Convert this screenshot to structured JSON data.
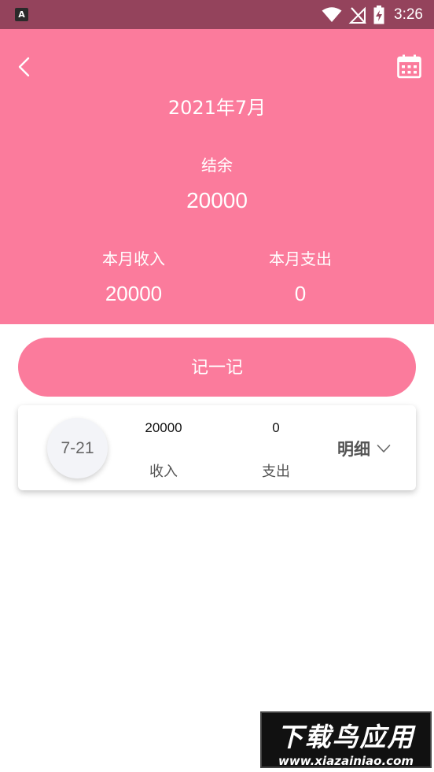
{
  "status_bar": {
    "app_icon_letter": "A",
    "time": "3:26"
  },
  "header": {
    "month": "2021年7月",
    "balance_label": "结余",
    "balance_value": "20000",
    "income_label": "本月收入",
    "income_value": "20000",
    "expense_label": "本月支出",
    "expense_value": "0"
  },
  "record_button": {
    "label": "记一记"
  },
  "day_card": {
    "date": "7-21",
    "income_value": "20000",
    "income_label": "收入",
    "expense_value": "0",
    "expense_label": "支出",
    "detail_label": "明细"
  },
  "watermark": {
    "title": "下载鸟应用",
    "url": "www.xiazainiao.com"
  },
  "colors": {
    "accent": "#fb7b9c",
    "status_bar": "#94435c"
  },
  "icons": {
    "back": "chevron-left-icon",
    "calendar": "calendar-icon",
    "detail": "chevron-down-icon",
    "wifi": "wifi-icon",
    "no_signal": "no-signal-icon",
    "battery": "battery-charging-icon"
  }
}
